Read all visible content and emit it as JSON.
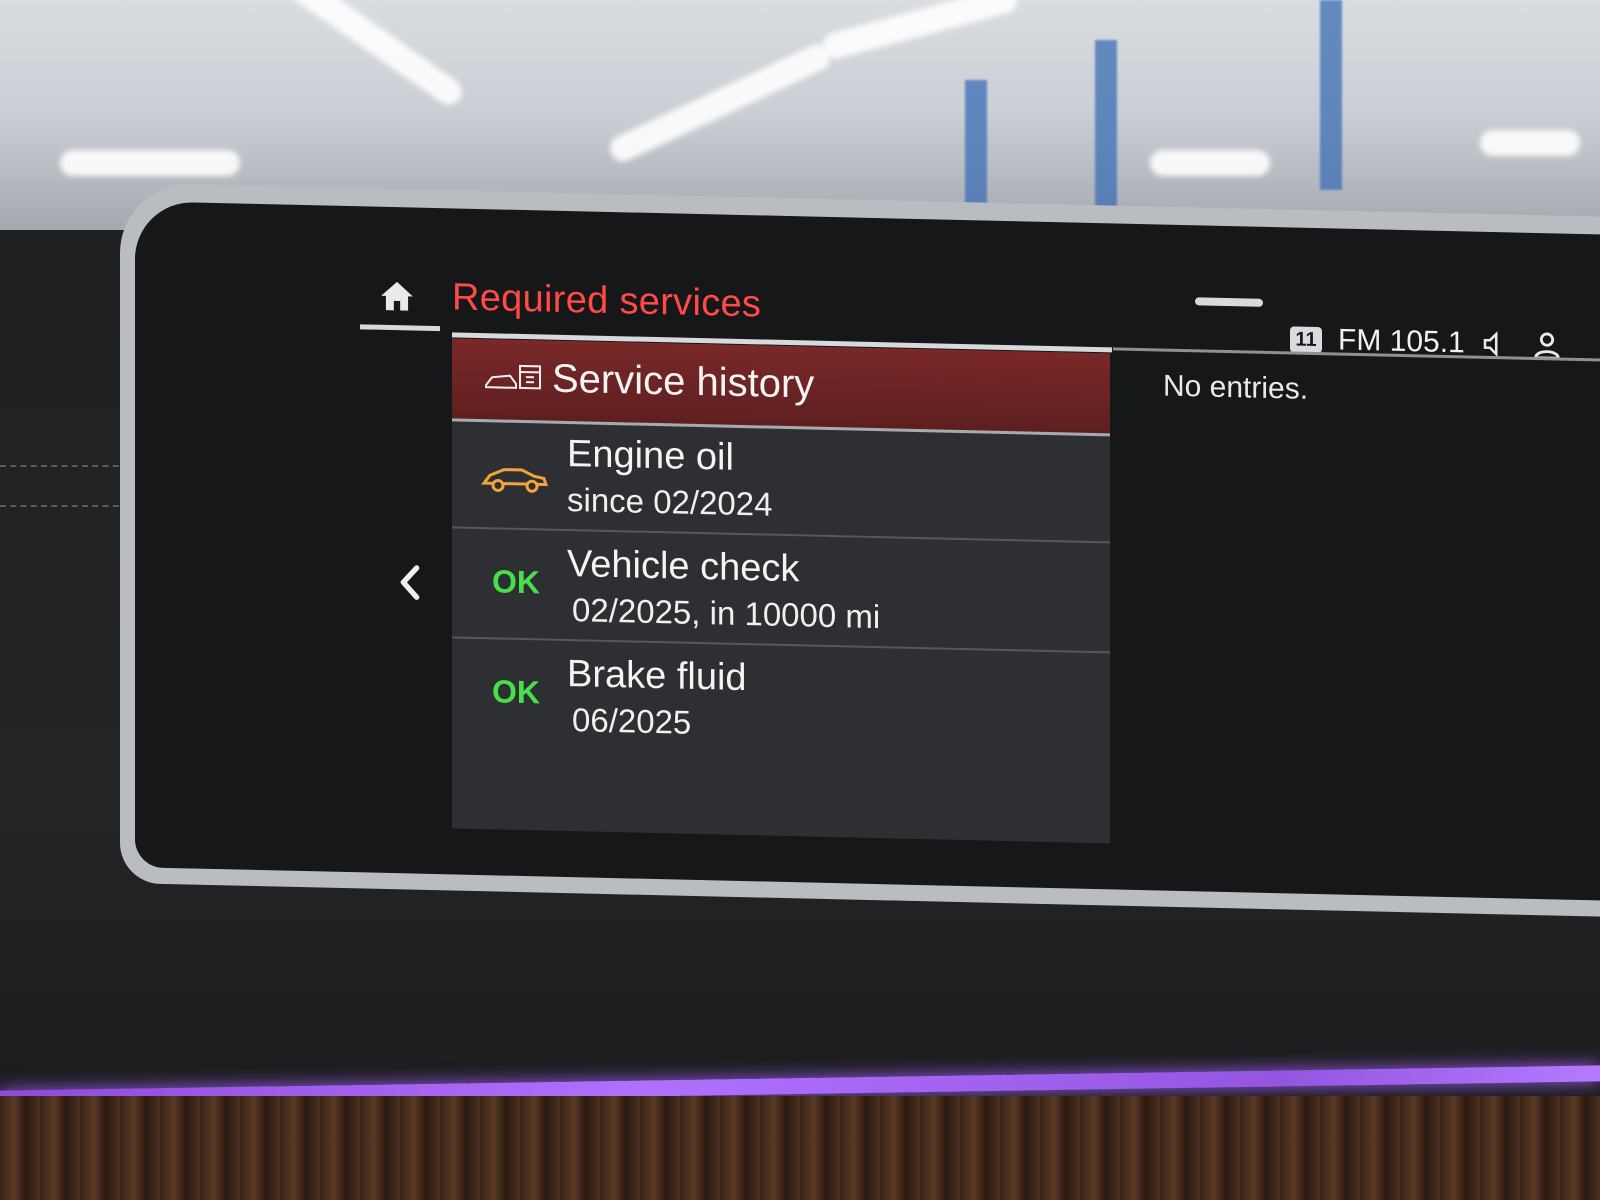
{
  "header": {
    "title": "Required services",
    "home_icon": "home-icon"
  },
  "status_bar": {
    "badge": "11",
    "radio": "FM 105.1",
    "speaker_icon": "speaker-icon",
    "profile_icon": "profile-icon"
  },
  "list": {
    "service_history": {
      "label": "Service history",
      "icon": "car-calendar-icon"
    },
    "items": [
      {
        "title": "Engine oil",
        "subtitle": "since 02/2024",
        "status_icon": "car-warning-icon",
        "status_color": "#f2a33a"
      },
      {
        "title": "Vehicle check",
        "subtitle": "02/2025, in 10000 mi",
        "status": "OK",
        "status_color": "#46e04a"
      },
      {
        "title": "Brake fluid",
        "subtitle": "06/2025",
        "status": "OK",
        "status_color": "#46e04a"
      }
    ]
  },
  "detail": {
    "message": "No entries."
  },
  "colors": {
    "title": "#ff4a45",
    "highlight_row": "#6e2424",
    "ambient": "#9a5cf0"
  }
}
